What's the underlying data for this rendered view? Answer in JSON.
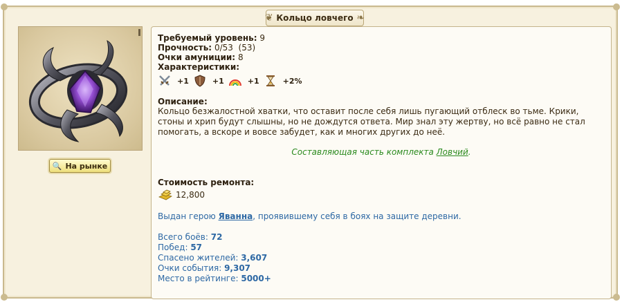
{
  "item": {
    "title": "Кольцо ловчего",
    "market_button": "На рынке"
  },
  "requirements": {
    "level_label": "Требуемый уровень:",
    "level_value": "9",
    "durability_label": "Прочность:",
    "durability_value": "0/53  (53)",
    "ammo_label": "Очки амуниции:",
    "ammo_value": "8",
    "characteristics_label": "Характеристики:"
  },
  "characteristics": [
    {
      "icon": "swords-icon",
      "value": "+1"
    },
    {
      "icon": "shield-icon",
      "value": "+1"
    },
    {
      "icon": "rainbow-icon",
      "value": "+1"
    },
    {
      "icon": "hourglass-icon",
      "value": "+2%"
    }
  ],
  "description": {
    "label": "Описание:",
    "text": "Кольцо безжалостной хватки, что оставит после себя лишь пугающий отблеск во тьме. Крики, стоны и хрип будут слышны, но не дождутся ответа. Мир знал эту жертву, но всё равно не стал помогать, а вскоре и вовсе забудет, как и многих других до неё."
  },
  "set": {
    "prefix": "Составляющая часть комплекта ",
    "link": "Ловчий",
    "suffix": "."
  },
  "repair": {
    "label": "Стоимость ремонта:",
    "gold": "12,800"
  },
  "hero": {
    "prefix": "Выдан герою ",
    "name": "Яванна",
    "suffix": ", проявившему себя в боях на защите деревни."
  },
  "stats": {
    "battles_label": "Всего боёв: ",
    "battles": "72",
    "wins_label": "Побед: ",
    "wins": "57",
    "saved_label": "Спасено жителей: ",
    "saved": "3,607",
    "event_label": "Очки события: ",
    "event": "9,307",
    "rating_label": "Место в рейтинге: ",
    "rating": "5000+"
  },
  "colors": {
    "accent_blue": "#2d68a4",
    "set_green": "#2b8a1e",
    "panel_bg": "#f7f1df"
  }
}
